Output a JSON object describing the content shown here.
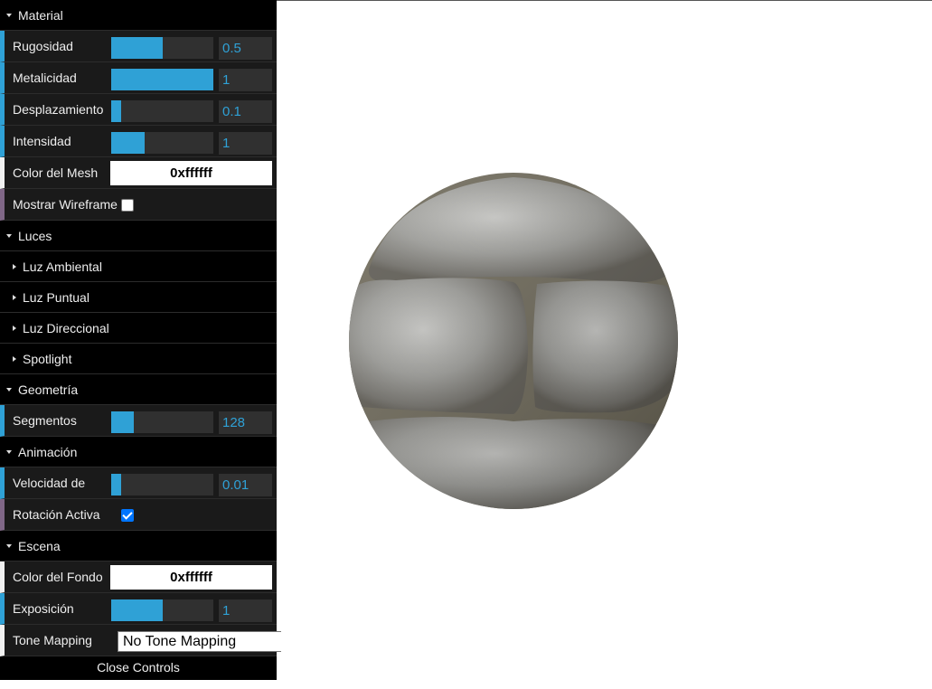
{
  "gui": {
    "folders": {
      "material": "Material",
      "luces": "Luces",
      "luz_ambiental": "Luz Ambiental",
      "luz_puntual": "Luz Puntual",
      "luz_direccional": "Luz Direccional",
      "spotlight": "Spotlight",
      "geometria": "Geometría",
      "animacion": "Animación",
      "escena": "Escena"
    },
    "material": {
      "rugosidad": {
        "label": "Rugosidad",
        "value": "0.5",
        "fill": 0.5
      },
      "metalicidad": {
        "label": "Metalicidad",
        "value": "1",
        "fill": 1.0
      },
      "desplazamiento": {
        "label": "Desplazamiento",
        "value": "0.1",
        "fill": 0.1
      },
      "intensidad": {
        "label": "Intensidad",
        "value": "1",
        "fill": 0.33
      },
      "color_mesh": {
        "label": "Color del Mesh",
        "value": "0xffffff"
      },
      "wireframe": {
        "label": "Mostrar Wireframe",
        "checked": false
      }
    },
    "geometria": {
      "segmentos": {
        "label": "Segmentos",
        "value": "128",
        "fill": 0.22
      }
    },
    "animacion": {
      "velocidad": {
        "label": "Velocidad de",
        "value": "0.01",
        "fill": 0.1
      },
      "rotacion": {
        "label": "Rotación Activa",
        "checked": true
      }
    },
    "escena": {
      "color_fondo": {
        "label": "Color del Fondo",
        "value": "0xffffff"
      },
      "exposicion": {
        "label": "Exposición",
        "value": "1",
        "fill": 0.5
      },
      "tone_mapping": {
        "label": "Tone Mapping",
        "value": "No Tone Mapping"
      }
    },
    "close_label": "Close Controls"
  },
  "colors": {
    "accent": "#2fa1d6",
    "panel_bg": "#1a1a1a",
    "title_bg": "#000000"
  },
  "viewport": {
    "object": "stone-sphere"
  }
}
